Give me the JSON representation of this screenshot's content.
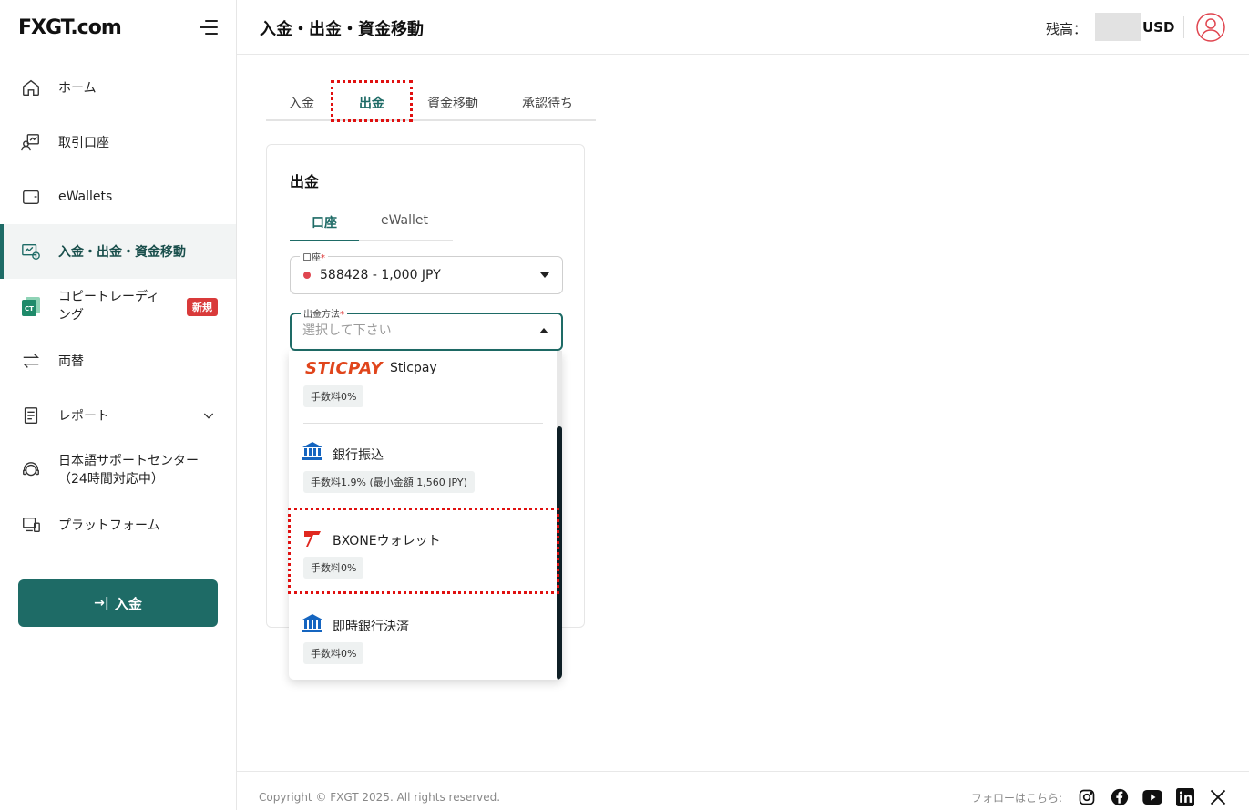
{
  "brand": {
    "logo_text": "FXGT.com"
  },
  "sidebar": {
    "items": [
      {
        "label": "ホーム",
        "icon": "home-icon"
      },
      {
        "label": "取引口座",
        "icon": "trading-account-icon"
      },
      {
        "label": "eWallets",
        "icon": "wallet-icon"
      },
      {
        "label": "入金・出金・資金移動",
        "icon": "funds-transfer-icon",
        "active": true
      },
      {
        "label": "コピートレーディング",
        "icon": "copy-trading-icon",
        "badge": "新規"
      },
      {
        "label": "両替",
        "icon": "exchange-icon"
      },
      {
        "label": "レポート",
        "icon": "report-icon"
      },
      {
        "label": "日本語サポートセンター（24時間対応中）",
        "icon": "support-icon"
      },
      {
        "label": "プラットフォーム",
        "icon": "platform-icon"
      }
    ],
    "copy_trading_line1": "コピートレーディ",
    "copy_trading_line2": "ング",
    "support_line1": "日本語サポートセンター",
    "support_line2": "（24時間対応中）",
    "deposit_button": "入金"
  },
  "header": {
    "title": "入金・出金・資金移動",
    "balance_label": "残高：",
    "balance_currency": "USD"
  },
  "tabs": [
    "入金",
    "出金",
    "資金移動",
    "承認待ち"
  ],
  "active_tab": "出金",
  "card": {
    "title": "出金",
    "subtabs": [
      "口座",
      "eWallet"
    ],
    "account_field": {
      "label": "口座",
      "value": "588428 - 1,000 JPY"
    },
    "method_field": {
      "label": "出金方法",
      "placeholder": "選択して下さい"
    }
  },
  "methods": [
    {
      "name": "Sticpay",
      "logo_text": "STICPAY",
      "fee": "手数料0%"
    },
    {
      "name": "銀行振込",
      "fee": "手数料1.9% (最小金額 1,560 JPY)"
    },
    {
      "name": "BXONEウォレット",
      "fee": "手数料0%"
    },
    {
      "name": "即時銀行決済",
      "fee": "手数料0%"
    }
  ],
  "footer": {
    "copyright": "Copyright © FXGT 2025. All rights reserved.",
    "follow_label": "フォローはこちら:",
    "social": [
      "instagram-icon",
      "facebook-icon",
      "youtube-icon",
      "linkedin-icon",
      "x-icon"
    ]
  },
  "colors": {
    "brand": "#1e6b66",
    "highlight": "#e01010",
    "badge": "#d93a3a"
  }
}
